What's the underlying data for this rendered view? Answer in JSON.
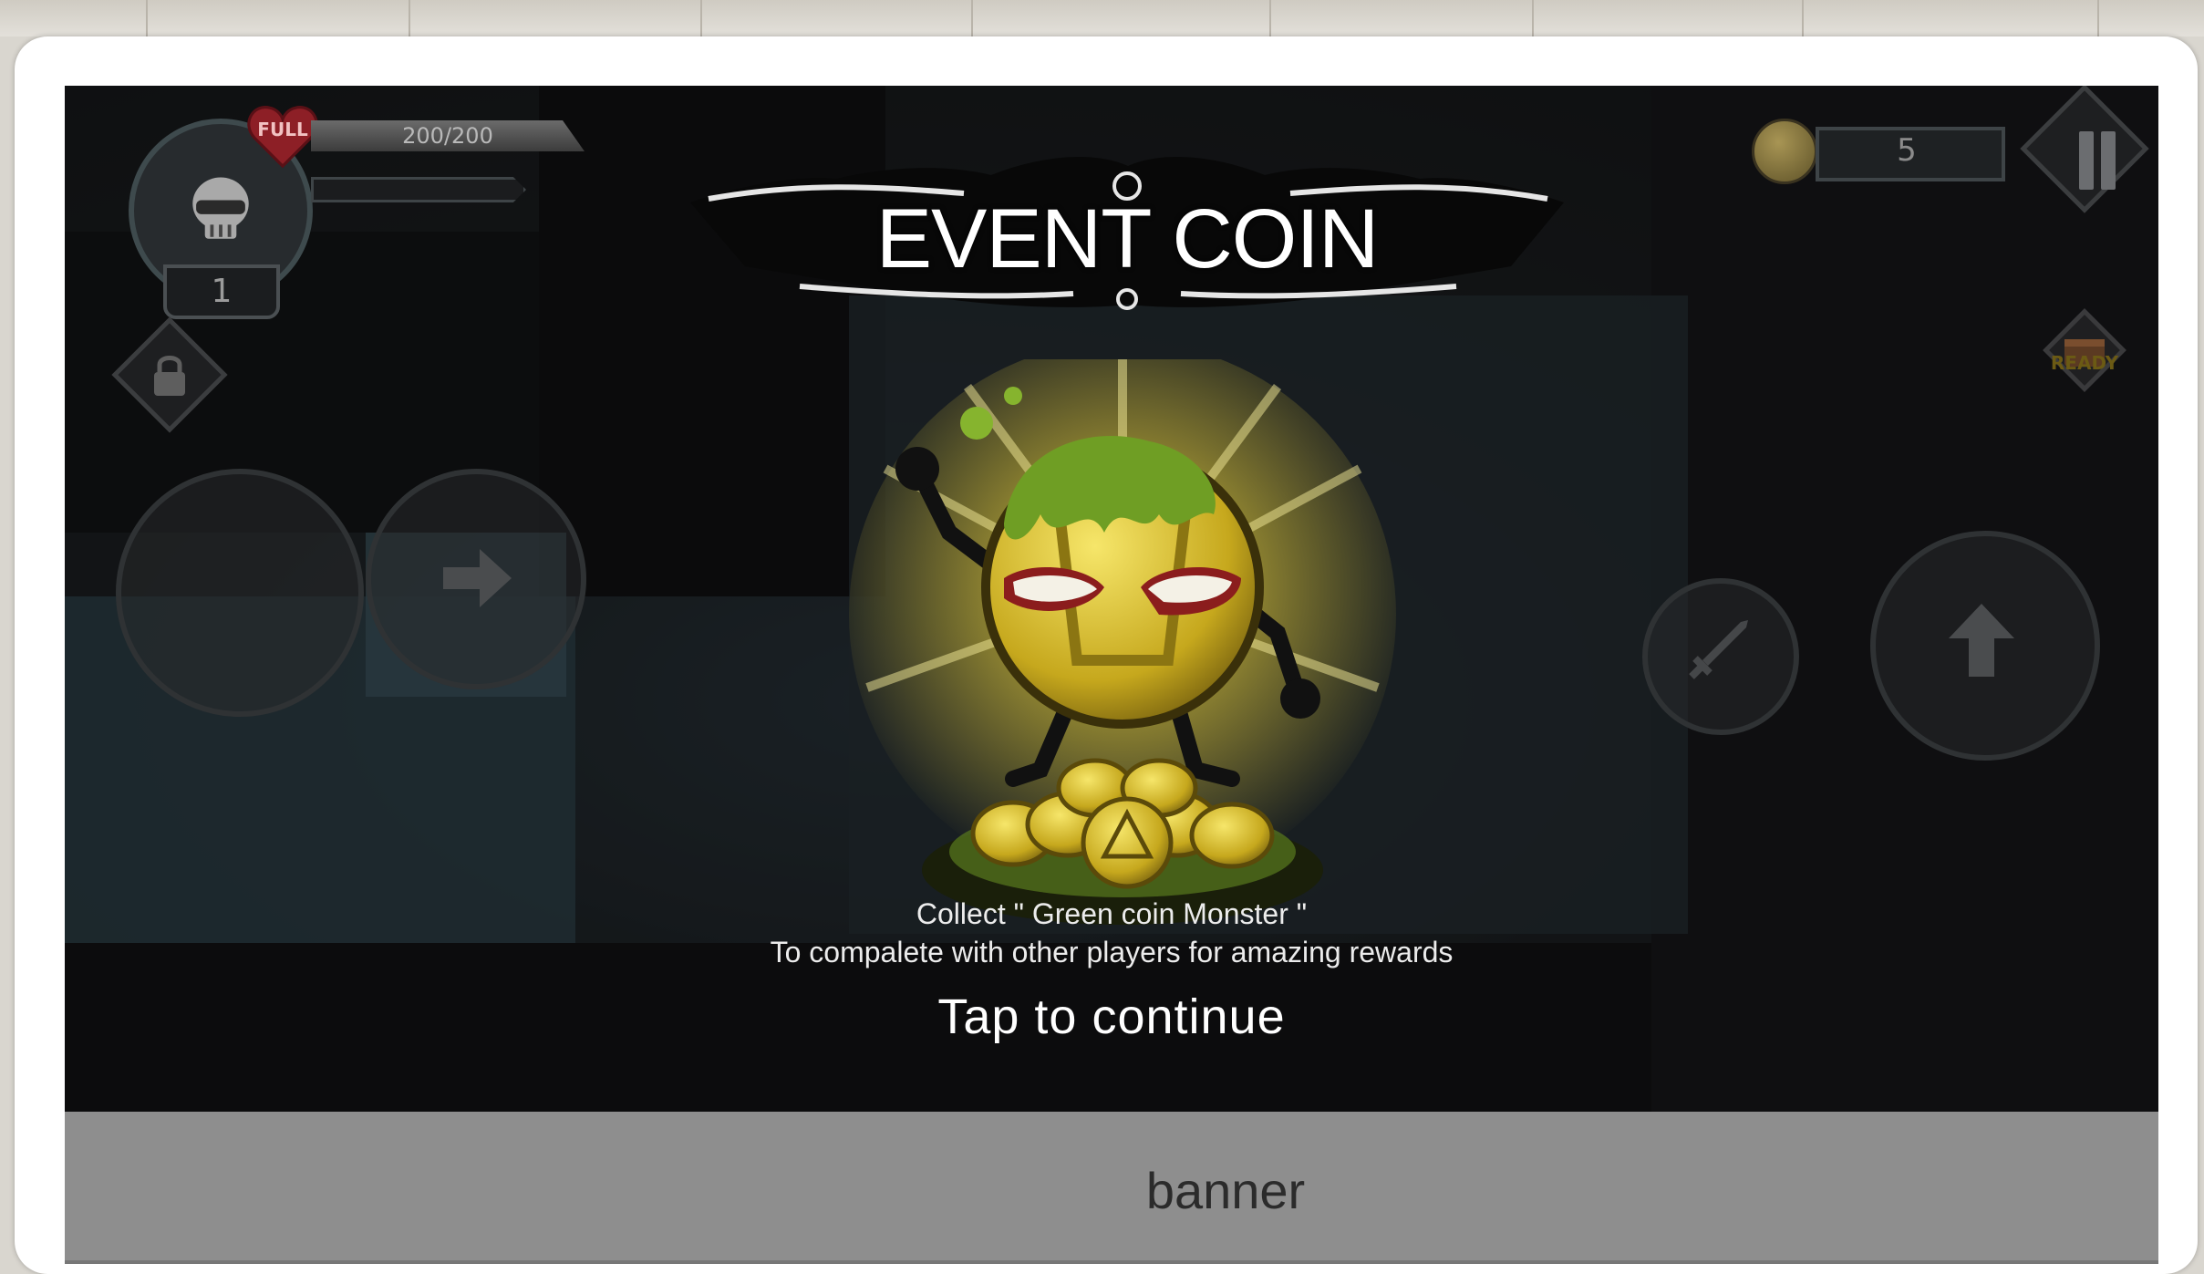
{
  "hud": {
    "heart_label": "FULL",
    "hp_text": "200/200",
    "level": "1",
    "coin_count": "5",
    "chest_status": "READY"
  },
  "popup": {
    "title": "EVENT COIN",
    "line1": "Collect \" Green coin Monster \"",
    "line2": "To compalete with other players for amazing rewards",
    "tap_prompt": "Tap to continue"
  },
  "ad": {
    "label": "banner"
  },
  "colors": {
    "accent_gold": "#e8d23a",
    "slime_green": "#7fae2c",
    "heart_red": "#b0262f",
    "banner_gray": "#8e8e8e"
  },
  "icons": [
    "skull-icon",
    "heart-icon",
    "lock-icon",
    "coin-icon",
    "pause-icon",
    "chest-icon",
    "arrow-right-icon",
    "sword-icon",
    "arrow-up-icon"
  ]
}
